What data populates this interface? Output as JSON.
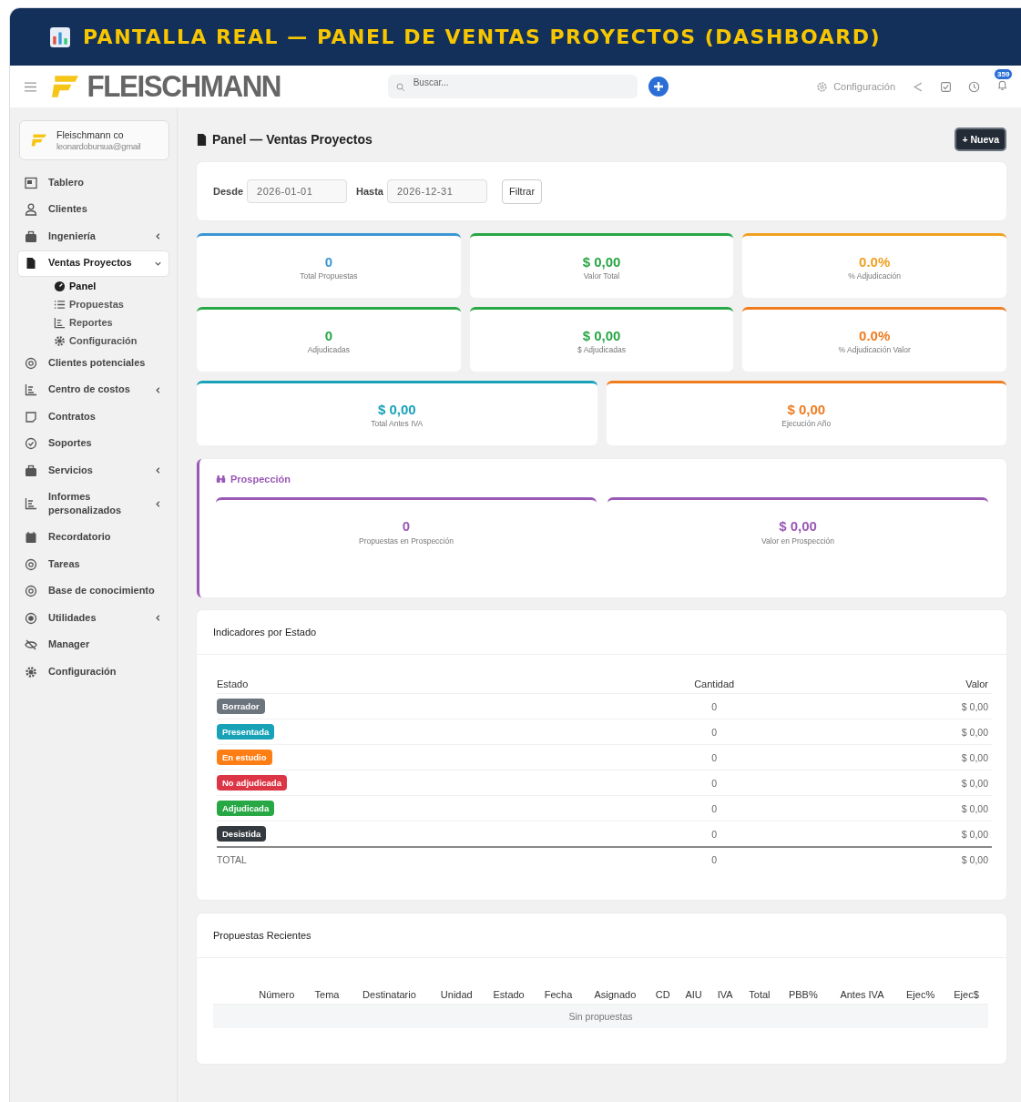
{
  "banner": {
    "title": "PANTALLA REAL — PANEL DE VENTAS PROYECTOS (DASHBOARD)"
  },
  "topbar": {
    "logo": "FLEISCHMANN",
    "search": {
      "placeholder": "Buscar..."
    },
    "config_link": "Configuración",
    "notifications": "359"
  },
  "account": {
    "name": "Fleischmann co",
    "email": "leonardobursua@gmail"
  },
  "sidebar": {
    "items": [
      {
        "label": "Tablero",
        "kind": "link",
        "selected": false
      },
      {
        "label": "Clientes",
        "kind": "link",
        "selected": false
      },
      {
        "label": "Ingeniería",
        "kind": "group",
        "selected": false,
        "expanded": false
      },
      {
        "label": "Ventas Proyectos",
        "kind": "group",
        "selected": true,
        "expanded": true,
        "children": [
          {
            "label": "Panel",
            "selected": true
          },
          {
            "label": "Propuestas",
            "selected": false
          },
          {
            "label": "Reportes",
            "selected": false
          },
          {
            "label": "Configuración",
            "selected": false
          }
        ]
      },
      {
        "label": "Clientes potenciales",
        "kind": "link",
        "selected": false
      },
      {
        "label": "Centro de costos",
        "kind": "group",
        "selected": false,
        "expanded": false
      },
      {
        "label": "Contratos",
        "kind": "link",
        "selected": false
      },
      {
        "label": "Soportes",
        "kind": "link",
        "selected": false
      },
      {
        "label": "Servicios",
        "kind": "group",
        "selected": false,
        "expanded": false
      },
      {
        "label": "Informes personalizados",
        "kind": "group",
        "selected": false,
        "expanded": false
      },
      {
        "label": "Recordatorio",
        "kind": "link",
        "selected": false
      },
      {
        "label": "Tareas",
        "kind": "link",
        "selected": false
      },
      {
        "label": "Base de conocimiento",
        "kind": "link",
        "selected": false
      },
      {
        "label": "Utilidades",
        "kind": "group",
        "selected": false,
        "expanded": false
      },
      {
        "label": "Manager",
        "kind": "link",
        "selected": false
      },
      {
        "label": "Configuración",
        "kind": "link",
        "selected": false
      }
    ]
  },
  "page": {
    "title": "Panel — Ventas Proyectos",
    "new_button": "+ Nueva"
  },
  "filter": {
    "from_label": "Desde",
    "from_value": "2026-01-01",
    "to_label": "Hasta",
    "to_value": "2026-12-31",
    "button": "Filtrar"
  },
  "stat_rows": [
    [
      {
        "value": "0",
        "label": "Total Propuestas",
        "color": "#3a97d4"
      },
      {
        "value": "$ 0,00",
        "label": "Valor Total",
        "color": "#28a745"
      },
      {
        "value": "0.0%",
        "label": "% Adjudicación",
        "color": "#f0a020"
      }
    ],
    [
      {
        "value": "0",
        "label": "Adjudicadas",
        "color": "#28a745"
      },
      {
        "value": "$ 0,00",
        "label": "$ Adjudicadas",
        "color": "#28a745"
      },
      {
        "value": "0.0%",
        "label": "% Adjudicación Valor",
        "color": "#f07c1e"
      }
    ],
    [
      {
        "value": "$ 0,00",
        "label": "Total Antes IVA",
        "color": "#17a2b8"
      },
      {
        "value": "$ 0,00",
        "label": "Ejecución Año",
        "color": "#f07c1e"
      }
    ]
  ],
  "prospeccion": {
    "title": "Prospección",
    "stats": [
      {
        "value": "0",
        "label": "Propuestas en Prospección"
      },
      {
        "value": "$ 0,00",
        "label": "Valor en Prospección"
      }
    ]
  },
  "indicadores": {
    "title": "Indicadores por Estado",
    "columns": [
      "Estado",
      "Cantidad",
      "Valor"
    ],
    "rows": [
      {
        "estado": "Borrador",
        "color": "#6c757d",
        "cantidad": "0",
        "valor": "$ 0,00"
      },
      {
        "estado": "Presentada",
        "color": "#17a2b8",
        "cantidad": "0",
        "valor": "$ 0,00"
      },
      {
        "estado": "En estudio",
        "color": "#fd7e14",
        "cantidad": "0",
        "valor": "$ 0,00"
      },
      {
        "estado": "No adjudicada",
        "color": "#dc3545",
        "cantidad": "0",
        "valor": "$ 0,00"
      },
      {
        "estado": "Adjudicada",
        "color": "#28a745",
        "cantidad": "0",
        "valor": "$ 0,00"
      },
      {
        "estado": "Desistida",
        "color": "#343a40",
        "cantidad": "0",
        "valor": "$ 0,00"
      }
    ],
    "total": {
      "label": "TOTAL",
      "cantidad": "0",
      "valor": "$ 0,00"
    }
  },
  "recientes": {
    "title": "Propuestas Recientes",
    "columns": [
      "Número",
      "Tema",
      "Destinatario",
      "Unidad",
      "Estado",
      "Fecha",
      "Asignado",
      "CD",
      "AIU",
      "IVA",
      "Total",
      "PBB%",
      "Antes IVA",
      "Ejec%",
      "Ejec$"
    ],
    "empty": "Sin propuestas"
  }
}
